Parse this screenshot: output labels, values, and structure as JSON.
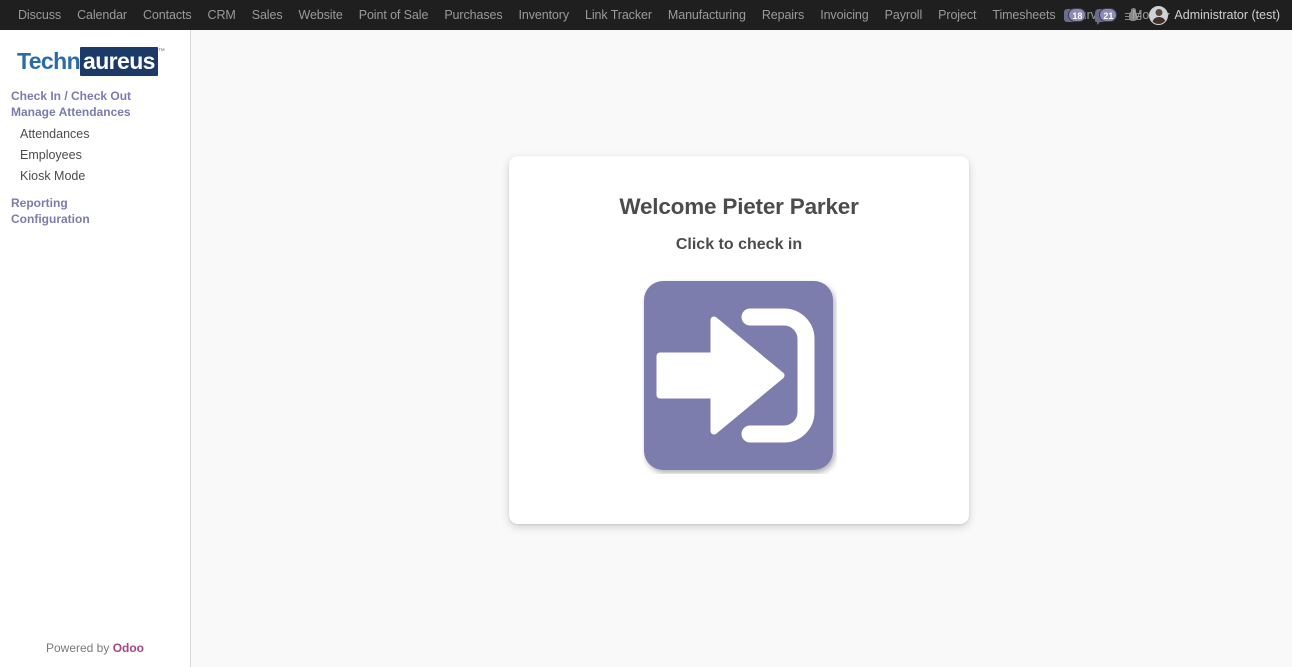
{
  "topbar": {
    "apps": [
      {
        "label": "Discuss",
        "name": "discuss"
      },
      {
        "label": "Calendar",
        "name": "calendar"
      },
      {
        "label": "Contacts",
        "name": "contacts"
      },
      {
        "label": "CRM",
        "name": "crm"
      },
      {
        "label": "Sales",
        "name": "sales"
      },
      {
        "label": "Website",
        "name": "website"
      },
      {
        "label": "Point of Sale",
        "name": "point-of-sale"
      },
      {
        "label": "Purchases",
        "name": "purchases"
      },
      {
        "label": "Inventory",
        "name": "inventory"
      },
      {
        "label": "Link Tracker",
        "name": "link-tracker"
      },
      {
        "label": "Manufacturing",
        "name": "manufacturing"
      },
      {
        "label": "Repairs",
        "name": "repairs"
      },
      {
        "label": "Invoicing",
        "name": "invoicing"
      },
      {
        "label": "Payroll",
        "name": "payroll"
      },
      {
        "label": "Project",
        "name": "project"
      },
      {
        "label": "Timesheets",
        "name": "timesheets"
      },
      {
        "label": "Surveys",
        "name": "surveys"
      }
    ],
    "more_label": "More",
    "activity_icon": "clipboard-icon",
    "activity_count": "18",
    "messages_icon": "speech-bubble-icon",
    "messages_count": "21",
    "debug_icon": "bug-icon",
    "avatar_icon": "user-avatar",
    "user_name": "Administrator (test)"
  },
  "sidebar": {
    "brand": {
      "part_a": "Techn",
      "part_b": "aureus",
      "trademark": "™"
    },
    "menu": [
      {
        "label": "Check In / Check Out",
        "name": "check-in-check-out",
        "type": "head"
      },
      {
        "label": "Manage Attendances",
        "name": "manage-attendances",
        "type": "head"
      },
      {
        "label": "Attendances",
        "name": "attendances",
        "type": "sub"
      },
      {
        "label": "Employees",
        "name": "employees",
        "type": "sub"
      },
      {
        "label": "Kiosk Mode",
        "name": "kiosk-mode",
        "type": "sub"
      },
      {
        "label": "Reporting",
        "name": "reporting",
        "type": "head"
      },
      {
        "label": "Configuration",
        "name": "configuration",
        "type": "head"
      }
    ],
    "footer": {
      "prefix": "Powered by ",
      "brand": "Odoo"
    }
  },
  "main": {
    "card": {
      "welcome_title": "Welcome Pieter Parker",
      "welcome_subtitle": "Click to check in",
      "signin_icon": "sign-in-arrow-icon"
    }
  },
  "colors": {
    "topbar_bg": "#1f1f1f",
    "sidebar_accent": "#7c7bad",
    "signin_purple": "#7b7bad",
    "odoo_brand": "#a24689",
    "logo_blue": "#2a6ca8",
    "logo_navy": "#1b3a68",
    "content_bg": "#f9f9f9"
  }
}
